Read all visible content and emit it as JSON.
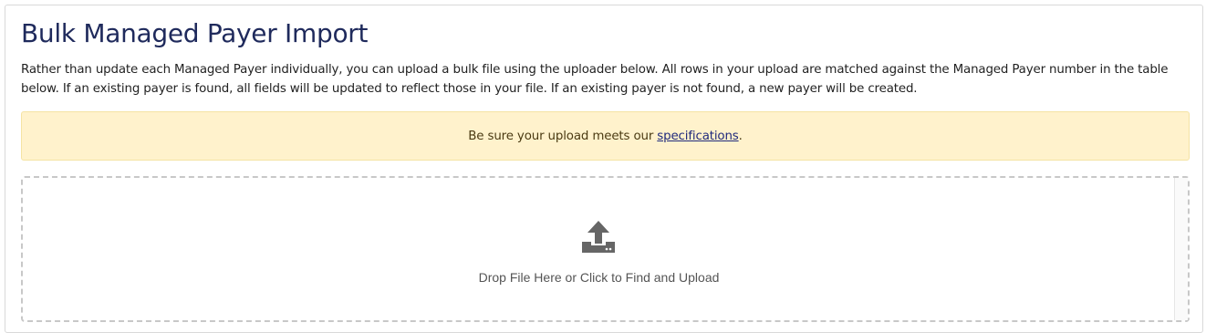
{
  "page": {
    "title": "Bulk Managed Payer Import",
    "description": "Rather than update each Managed Payer individually, you can upload a bulk file using the uploader below. All rows in your upload are matched against the Managed Payer number in the table below. If an existing payer is found, all fields will be updated to reflect those in your file. If an existing payer is not found, a new payer will be created."
  },
  "notice": {
    "prefix": "Be sure your upload meets our ",
    "link_text": "specifications",
    "suffix": ".",
    "background_color": "#fff2cc"
  },
  "dropzone": {
    "icon": "upload-icon",
    "label": "Drop File Here or Click to Find and Upload"
  },
  "colors": {
    "title": "#1f2a5c",
    "link": "#1f2a7c",
    "icon": "#666666"
  }
}
